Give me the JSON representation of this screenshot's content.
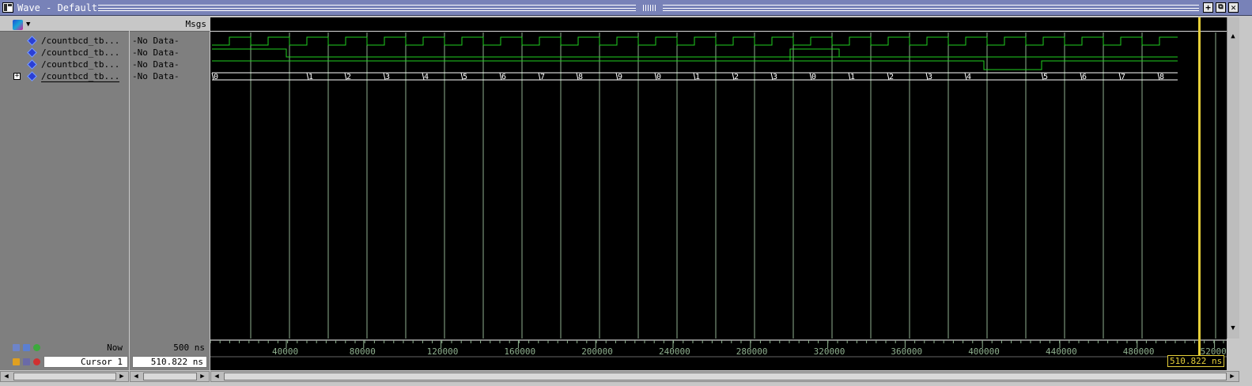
{
  "window": {
    "title": "Wave - Default",
    "buttons": {
      "maximize": "+",
      "restore": "⧉",
      "close": "✕"
    }
  },
  "headers": {
    "msgs": "Msgs"
  },
  "signals": [
    {
      "name": "/countbcd_tb...",
      "msg": "-No Data-",
      "expandable": false
    },
    {
      "name": "/countbcd_tb...",
      "msg": "-No Data-",
      "expandable": false
    },
    {
      "name": "/countbcd_tb...",
      "msg": "-No Data-",
      "expandable": false
    },
    {
      "name": "/countbcd_tb...",
      "msg": "-No Data-",
      "expandable": true
    }
  ],
  "bus_values": [
    "0",
    "1",
    "2",
    "3",
    "4",
    "5",
    "6",
    "7",
    "8",
    "9",
    "0",
    "1",
    "2",
    "3",
    "0",
    "1",
    "2",
    "3",
    "4",
    "5",
    "6",
    "7",
    "8"
  ],
  "timeline": {
    "ticks": [
      "40000",
      "80000",
      "120000",
      "160000",
      "200000",
      "240000",
      "280000",
      "320000",
      "360000",
      "400000",
      "440000",
      "480000",
      "52000"
    ],
    "now_label": "Now",
    "now_value": "500 ns",
    "cursor_name": "Cursor 1",
    "cursor_value": "510.822 ns",
    "cursor_readout": "510.822 ns"
  },
  "colors": {
    "wave": "#20d020",
    "cursor": "#e5cf39",
    "grid": "#8fb08f",
    "background": "#000000",
    "panel": "#7f7f7f"
  },
  "icons": [
    "hierarchy-icon",
    "signal-diamond-icon",
    "expand-plus-icon",
    "zoom-icon",
    "lock-icon",
    "cursor-add-icon",
    "cursor-remove-icon"
  ]
}
